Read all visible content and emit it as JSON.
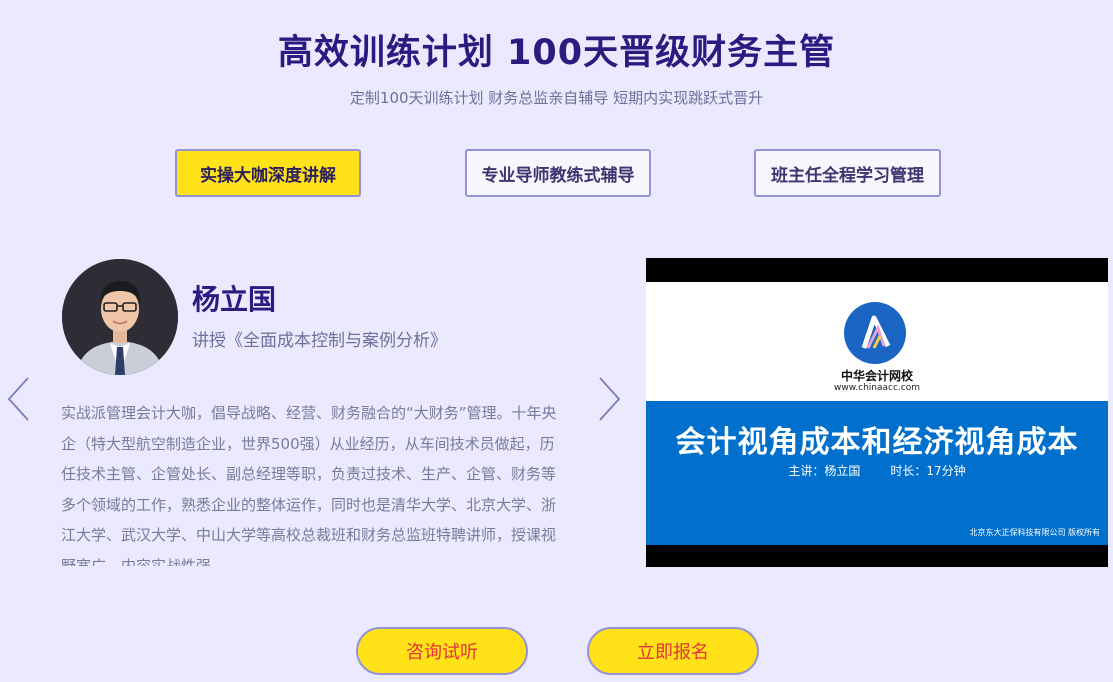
{
  "header": {
    "title": "高效训练计划 100天晋级财务主管",
    "subtitle": "定制100天训练计划 财务总监亲自辅导 短期内实现跳跃式晋升"
  },
  "tabs": [
    {
      "label": "实操大咖深度讲解",
      "active": true
    },
    {
      "label": "专业导师教练式辅导",
      "active": false
    },
    {
      "label": "班主任全程学习管理",
      "active": false
    }
  ],
  "teacher": {
    "name": "杨立国",
    "course": "讲授《全面成本控制与案例分析》",
    "bio": "实战派管理会计大咖，倡导战略、经营、财务融合的“大财务”管理。十年央企（特大型航空制造企业，世界500强）从业经历，从车间技术员做起，历任技术主管、企管处长、副总经理等职，负责过技术、生产、企管、财务等多个领域的工作，熟悉企业的整体运作，同时也是清华大学、北京大学、浙江大学、武汉大学、中山大学等高校总裁班和财务总监班特聘讲师，授课视野宽广，内容实战性强。"
  },
  "carousel": {
    "prev_icon": "chevron-left-icon",
    "next_icon": "chevron-right-icon"
  },
  "video": {
    "brand_name": "中华会计网校",
    "brand_url": "www.chinaacc.com",
    "title": "会计视角成本和经济视角成本",
    "lecturer": "主讲：杨立国",
    "duration": "时长：17分钟",
    "copyright": "北京东大正保科技有限公司 版权所有"
  },
  "actions": {
    "consult_label": "咨询试听",
    "signup_label": "立即报名"
  },
  "colors": {
    "background": "#eae9fd",
    "title": "#2b1a7f",
    "accent_yellow": "#ffe217",
    "cta_text": "#e2343a",
    "video_blue": "#0070cc"
  }
}
